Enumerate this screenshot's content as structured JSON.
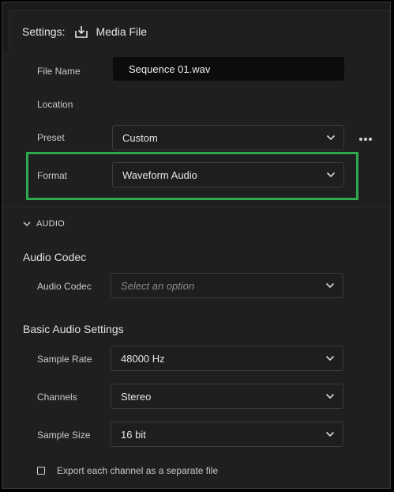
{
  "header": {
    "settings_label": "Settings:",
    "media_label": "Media File",
    "export_icon": "download-icon"
  },
  "file": {
    "name_label": "File Name",
    "name_value": "Sequence 01.wav",
    "location_label": "Location",
    "preset_label": "Preset",
    "preset_value": "Custom",
    "more_icon": "more-options-icon",
    "format_label": "Format",
    "format_value": "Waveform Audio"
  },
  "audio_section": {
    "toggle_label": "AUDIO",
    "codec_heading": "Audio Codec",
    "codec_label": "Audio Codec",
    "codec_placeholder": "Select an option",
    "basic_heading": "Basic Audio Settings",
    "sample_rate_label": "Sample Rate",
    "sample_rate_value": "48000 Hz",
    "channels_label": "Channels",
    "channels_value": "Stereo",
    "sample_size_label": "Sample Size",
    "sample_size_value": "16 bit",
    "separate_file_label": "Export each channel as a separate file",
    "separate_file_checked": false
  },
  "colors": {
    "highlight": "#2fa84f",
    "panel_bg": "#1f1f1f",
    "field_bg": "#0c0c0c"
  }
}
